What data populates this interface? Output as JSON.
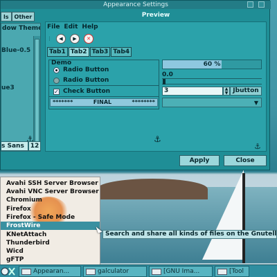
{
  "window": {
    "title": "Appearance Settings",
    "left_tabs": [
      "ls",
      "Other"
    ],
    "theme_list_header": "dow Themes",
    "theme_items": [
      "Blue-0.5",
      "ue3"
    ],
    "font_name": "s Sans",
    "font_size": "12",
    "preview_header": "Preview",
    "apply_label": "Apply",
    "close_label": "Close",
    "anchor_glyph": "⚓"
  },
  "preview": {
    "menu": [
      "File",
      "Edit",
      "Help"
    ],
    "tabs": [
      "Tab1",
      "Tab2",
      "Tab3",
      "Tab4"
    ],
    "active_tab": 1,
    "demo_label": "Demo",
    "radio1": "Radio Button",
    "radio2": "Radio Button",
    "check": "Check Button",
    "final_left": "*******",
    "final_mid": "FINAL",
    "final_right": "********",
    "progress_text": "60 %",
    "progress_value": 0.6,
    "slider_value_text": "0.0",
    "spin_value": "3",
    "small_button": "Jbutton",
    "back_icon": "◀",
    "forward_icon": "▶",
    "stop_icon": "✕",
    "combo_arrow": "▼",
    "anchor_glyph": "⚓"
  },
  "menu": {
    "items": [
      "Avahi SSH Server Browser",
      "Avahi VNC Server Browser",
      "Chromium",
      "Firefox",
      "Firefox - Safe Mode",
      "FrostWire",
      "KNetAttach",
      "Thunderbird",
      "Wicd",
      "gFTP"
    ],
    "highlighted": 5
  },
  "tooltip": "Search and share all kinds of files on the Gnutella netwo",
  "taskbar": {
    "tasks": [
      "Appearan...",
      "galculator",
      "[GNU Ima...",
      "[Tool"
    ]
  }
}
